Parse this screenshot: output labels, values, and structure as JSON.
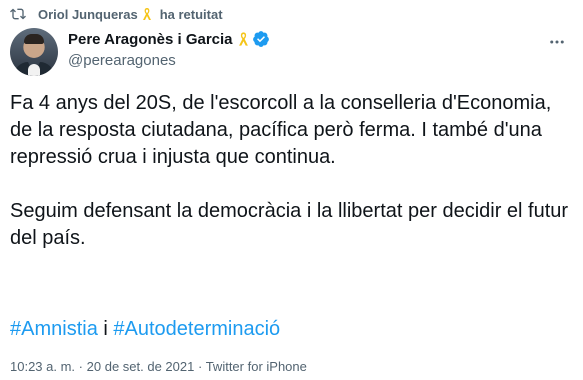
{
  "retweet": {
    "user": "Oriol Junqueras",
    "action": "ha retuitat"
  },
  "author": {
    "name": "Pere Aragonès i Garcia",
    "handle": "@perearagones"
  },
  "tweet": {
    "paragraph_1": "Fa 4 anys del 20S, de l'escorcoll a la conselleria d'Economia, de la resposta ciutadana, pacífica però ferma. I també d'una repressió crua i injusta que continua.",
    "paragraph_2": "Seguim defensant la democràcia i la llibertat per decidir el futur del país.",
    "hashtag_1": "#Amnistia",
    "separator": "i",
    "hashtag_2": "#Autodeterminació"
  },
  "meta": {
    "time": "10:23 a. m.",
    "dot": "·",
    "date": "20 de set. de 2021",
    "source": "Twitter for iPhone"
  },
  "colors": {
    "text": "#0f1419",
    "secondary": "#536471",
    "link": "#1d9bf0",
    "ribbon": "#f5c518",
    "verified": "#1d9bf0"
  }
}
